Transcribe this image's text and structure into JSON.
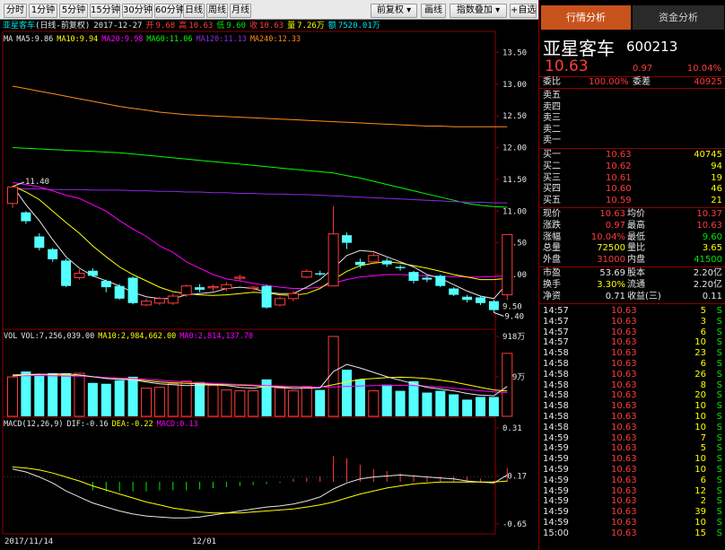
{
  "toolbar": {
    "buttons": [
      "分时",
      "1分钟",
      "5分钟",
      "15分钟",
      "30分钟",
      "60分钟",
      "日线",
      "周线",
      "月线"
    ],
    "restore": "前复权",
    "drawing": "画线",
    "indicator": "指数叠加",
    "selfselect": "+自选"
  },
  "header": {
    "name": "亚星客车",
    "period": "(日线-前复权)",
    "date": "2017-12-27",
    "open_label": "开",
    "open": "9.68",
    "high_label": "高",
    "high": "10.63",
    "low_label": "低",
    "low": "9.60",
    "close_label": "收",
    "close": "10.63",
    "vol_label": "量",
    "vol": "7.26万",
    "amt_label": "额",
    "amt": "7520.01万"
  },
  "ma_legend": [
    {
      "text": "MA",
      "color": "#e6e6e6"
    },
    {
      "text": "MA5:9.86",
      "color": "#e6e6e6"
    },
    {
      "text": "MA10:9.94",
      "color": "#ffff00"
    },
    {
      "text": "MA20:9.98",
      "color": "#ff00ff"
    },
    {
      "text": "MA60:11.06",
      "color": "#00ff00"
    },
    {
      "text": "MA120:11.13",
      "color": "#8a2be2"
    },
    {
      "text": "MA240:12.33",
      "color": "#ff8c1a"
    }
  ],
  "vol_legend": [
    {
      "text": "VOL",
      "color": "#e6e6e6"
    },
    {
      "text": "VOL:7,256,039.00",
      "color": "#e6e6e6"
    },
    {
      "text": "MA10:2,984,662.00",
      "color": "#ffff00"
    },
    {
      "text": "MA0:2,814,137.70",
      "color": "#ff00ff"
    }
  ],
  "macd_legend": [
    {
      "text": "MACD(12,26,9)",
      "color": "#e6e6e6"
    },
    {
      "text": "DIF:-0.16",
      "color": "#e6e6e6"
    },
    {
      "text": "DEA:-0.22",
      "color": "#ffff00"
    },
    {
      "text": "MACD:0.13",
      "color": "#ff00ff"
    }
  ],
  "price_axis": [
    "13.50",
    "13.00",
    "12.50",
    "12.00",
    "11.50",
    "11.00",
    "10.50",
    "10.00",
    "9.50"
  ],
  "vol_axis": [
    "918万",
    "459万"
  ],
  "macd_axis": [
    "0.31",
    "-0.17",
    "-0.65"
  ],
  "date_axis": [
    "2017/11/14",
    "12/01"
  ],
  "annotations": {
    "high": "11.40",
    "low": "9.40"
  },
  "candles": [
    {
      "o": 11.12,
      "c": 11.38,
      "h": 11.4,
      "l": 11.05,
      "v": 458
    },
    {
      "o": 10.98,
      "c": 10.84,
      "h": 11.0,
      "l": 10.8,
      "v": 520
    },
    {
      "o": 10.6,
      "c": 10.42,
      "h": 10.65,
      "l": 10.38,
      "v": 470
    },
    {
      "o": 10.4,
      "c": 10.24,
      "h": 10.42,
      "l": 10.2,
      "v": 500
    },
    {
      "o": 10.22,
      "c": 9.82,
      "h": 10.25,
      "l": 9.8,
      "v": 500
    },
    {
      "o": 9.95,
      "c": 10.02,
      "h": 10.08,
      "l": 9.92,
      "v": 500
    },
    {
      "o": 10.06,
      "c": 9.98,
      "h": 10.1,
      "l": 9.96,
      "v": 390
    },
    {
      "o": 9.9,
      "c": 9.8,
      "h": 9.92,
      "l": 9.72,
      "v": 380
    },
    {
      "o": 9.82,
      "c": 9.62,
      "h": 9.85,
      "l": 9.6,
      "v": 420
    },
    {
      "o": 9.95,
      "c": 9.55,
      "h": 9.97,
      "l": 9.53,
      "v": 460
    },
    {
      "o": 9.52,
      "c": 9.58,
      "h": 9.62,
      "l": 9.5,
      "v": 330
    },
    {
      "o": 9.55,
      "c": 9.62,
      "h": 9.65,
      "l": 9.52,
      "v": 340
    },
    {
      "o": 9.55,
      "c": 9.66,
      "h": 9.7,
      "l": 9.52,
      "v": 380
    },
    {
      "o": 9.68,
      "c": 9.82,
      "h": 9.84,
      "l": 9.65,
      "v": 410
    },
    {
      "o": 9.8,
      "c": 9.76,
      "h": 9.85,
      "l": 9.72,
      "v": 400
    },
    {
      "o": 9.79,
      "c": 9.81,
      "h": 9.84,
      "l": 9.74,
      "v": 360
    },
    {
      "o": 9.78,
      "c": 9.84,
      "h": 9.88,
      "l": 9.74,
      "v": 310
    },
    {
      "o": 9.94,
      "c": 9.96,
      "h": 10.0,
      "l": 9.9,
      "v": 300
    },
    {
      "o": 9.78,
      "c": 9.8,
      "h": 9.82,
      "l": 9.75,
      "v": 300
    },
    {
      "o": 9.82,
      "c": 9.48,
      "h": 9.84,
      "l": 9.46,
      "v": 430
    },
    {
      "o": 9.52,
      "c": 9.62,
      "h": 9.65,
      "l": 9.5,
      "v": 330
    },
    {
      "o": 9.62,
      "c": 9.7,
      "h": 9.74,
      "l": 9.58,
      "v": 300
    },
    {
      "o": 9.96,
      "c": 10.05,
      "h": 10.08,
      "l": 9.94,
      "v": 350
    },
    {
      "o": 10.02,
      "c": 10.0,
      "h": 10.06,
      "l": 9.98,
      "v": 310
    },
    {
      "o": 9.82,
      "c": 10.64,
      "h": 11.08,
      "l": 9.82,
      "v": 918
    },
    {
      "o": 10.62,
      "c": 10.5,
      "h": 10.66,
      "l": 10.4,
      "v": 540
    },
    {
      "o": 10.2,
      "c": 10.15,
      "h": 10.25,
      "l": 10.1,
      "v": 430
    },
    {
      "o": 10.2,
      "c": 10.3,
      "h": 10.34,
      "l": 10.16,
      "v": 300
    },
    {
      "o": 10.22,
      "c": 10.16,
      "h": 10.26,
      "l": 10.12,
      "v": 370
    },
    {
      "o": 10.12,
      "c": 10.1,
      "h": 10.15,
      "l": 10.06,
      "v": 300
    },
    {
      "o": 10.04,
      "c": 9.9,
      "h": 10.06,
      "l": 9.86,
      "v": 410
    },
    {
      "o": 9.95,
      "c": 9.92,
      "h": 9.98,
      "l": 9.88,
      "v": 280
    },
    {
      "o": 9.98,
      "c": 9.82,
      "h": 10.0,
      "l": 9.8,
      "v": 300
    },
    {
      "o": 9.78,
      "c": 9.68,
      "h": 9.8,
      "l": 9.66,
      "v": 260
    },
    {
      "o": 9.65,
      "c": 9.6,
      "h": 9.68,
      "l": 9.56,
      "v": 200
    },
    {
      "o": 9.64,
      "c": 9.55,
      "h": 9.66,
      "l": 9.52,
      "v": 230
    },
    {
      "o": 9.58,
      "c": 9.44,
      "h": 9.6,
      "l": 9.4,
      "v": 230
    },
    {
      "o": 9.68,
      "c": 10.63,
      "h": 10.63,
      "l": 9.6,
      "v": 726
    }
  ],
  "ma_lines": [
    {
      "color": "#ff8c1a",
      "values": [
        12.97,
        12.93,
        12.89,
        12.85,
        12.81,
        12.77,
        12.73,
        12.69,
        12.65,
        12.62,
        12.59,
        12.56,
        12.54,
        12.52,
        12.51,
        12.5,
        12.49,
        12.48,
        12.47,
        12.46,
        12.45,
        12.44,
        12.43,
        12.42,
        12.41,
        12.4,
        12.39,
        12.38,
        12.37,
        12.36,
        12.35,
        12.34,
        12.34,
        12.33,
        12.33,
        12.33,
        12.33,
        12.33
      ]
    },
    {
      "color": "#00ff00",
      "values": [
        12.0,
        11.99,
        11.98,
        11.97,
        11.96,
        11.95,
        11.94,
        11.93,
        11.92,
        11.9,
        11.88,
        11.86,
        11.84,
        11.82,
        11.8,
        11.78,
        11.76,
        11.74,
        11.72,
        11.7,
        11.68,
        11.66,
        11.64,
        11.62,
        11.6,
        11.56,
        11.52,
        11.47,
        11.42,
        11.37,
        11.32,
        11.27,
        11.22,
        11.17,
        11.12,
        11.09,
        11.07,
        11.06
      ]
    },
    {
      "color": "#8a2be2",
      "values": [
        11.35,
        11.35,
        11.35,
        11.34,
        11.34,
        11.34,
        11.33,
        11.33,
        11.33,
        11.32,
        11.32,
        11.31,
        11.31,
        11.3,
        11.3,
        11.29,
        11.29,
        11.28,
        11.28,
        11.27,
        11.27,
        11.26,
        11.26,
        11.25,
        11.24,
        11.23,
        11.22,
        11.21,
        11.2,
        11.19,
        11.18,
        11.17,
        11.16,
        11.15,
        11.14,
        11.14,
        11.13,
        11.13
      ]
    },
    {
      "color": "#ff00ff",
      "values": [
        11.45,
        11.42,
        11.38,
        11.32,
        11.25,
        11.2,
        11.1,
        11.0,
        10.85,
        10.72,
        10.6,
        10.45,
        10.35,
        10.2,
        10.1,
        10.0,
        9.93,
        9.9,
        9.86,
        9.83,
        9.8,
        9.78,
        9.78,
        9.8,
        9.86,
        9.92,
        9.96,
        9.98,
        10.0,
        10.0,
        9.99,
        9.98,
        9.97,
        9.97,
        9.96,
        9.96,
        9.97,
        9.98
      ]
    },
    {
      "color": "#ffff00",
      "values": [
        11.4,
        11.3,
        11.18,
        11.0,
        10.82,
        10.65,
        10.45,
        10.28,
        10.12,
        10.0,
        9.9,
        9.8,
        9.73,
        9.7,
        9.68,
        9.67,
        9.68,
        9.7,
        9.72,
        9.71,
        9.68,
        9.67,
        9.7,
        9.78,
        9.92,
        10.05,
        10.14,
        10.18,
        10.2,
        10.18,
        10.14,
        10.1,
        10.05,
        10.0,
        9.96,
        9.92,
        9.92,
        9.94
      ]
    },
    {
      "color": "#e6e6e6",
      "values": [
        11.4,
        11.1,
        10.85,
        10.55,
        10.28,
        10.1,
        9.98,
        9.9,
        9.82,
        9.72,
        9.65,
        9.62,
        9.62,
        9.68,
        9.7,
        9.72,
        9.78,
        9.8,
        9.78,
        9.72,
        9.7,
        9.7,
        9.8,
        9.92,
        10.1,
        10.3,
        10.38,
        10.36,
        10.28,
        10.2,
        10.12,
        10.0,
        9.94,
        9.84,
        9.74,
        9.66,
        9.62,
        9.86
      ]
    }
  ],
  "vol_ma_lines": [
    {
      "color": "#ffff00",
      "values": [
        480,
        485,
        490,
        485,
        478,
        470,
        460,
        450,
        440,
        430,
        415,
        400,
        392,
        385,
        380,
        375,
        370,
        365,
        358,
        352,
        348,
        345,
        342,
        340,
        370,
        400,
        430,
        440,
        450,
        455,
        450,
        440,
        420,
        400,
        370,
        340,
        310,
        298
      ]
    },
    {
      "color": "#ff00ff",
      "values": [
        470,
        472,
        474,
        470,
        468,
        466,
        460,
        452,
        445,
        440,
        430,
        420,
        410,
        400,
        392,
        385,
        378,
        372,
        366,
        360,
        355,
        350,
        345,
        342,
        345,
        350,
        356,
        360,
        362,
        362,
        360,
        352,
        342,
        330,
        315,
        300,
        288,
        281
      ]
    },
    {
      "color": "#e6e6e6",
      "values": [
        470,
        480,
        486,
        490,
        495,
        480,
        460,
        440,
        430,
        425,
        400,
        380,
        370,
        360,
        365,
        370,
        360,
        340,
        330,
        350,
        340,
        325,
        330,
        335,
        520,
        600,
        560,
        510,
        460,
        420,
        380,
        340,
        320,
        300,
        270,
        250,
        245,
        350
      ]
    }
  ],
  "macd": {
    "bars": [
      0,
      0,
      0,
      0,
      0,
      0,
      -0.08,
      -0.09,
      -0.09,
      -0.09,
      -0.09,
      -0.08,
      -0.08,
      -0.08,
      -0.07,
      -0.06,
      -0.05,
      -0.04,
      -0.03,
      -0.02,
      -0.01,
      0.03,
      0.04,
      0.05,
      0.24,
      0.22,
      0.16,
      0.12,
      0.1,
      0.08,
      0.06,
      0.05,
      0.05,
      0.05,
      0.05,
      0.03,
      0.01,
      0.13
    ],
    "dif": [
      -0.1,
      -0.13,
      -0.18,
      -0.24,
      -0.32,
      -0.38,
      -0.44,
      -0.48,
      -0.52,
      -0.55,
      -0.57,
      -0.58,
      -0.59,
      -0.59,
      -0.58,
      -0.56,
      -0.54,
      -0.52,
      -0.5,
      -0.48,
      -0.47,
      -0.45,
      -0.42,
      -0.38,
      -0.3,
      -0.24,
      -0.2,
      -0.18,
      -0.17,
      -0.16,
      -0.17,
      -0.18,
      -0.19,
      -0.2,
      -0.22,
      -0.23,
      -0.24,
      -0.16
    ],
    "dea": [
      -0.08,
      -0.09,
      -0.11,
      -0.14,
      -0.18,
      -0.22,
      -0.27,
      -0.31,
      -0.35,
      -0.39,
      -0.43,
      -0.46,
      -0.49,
      -0.51,
      -0.53,
      -0.54,
      -0.54,
      -0.54,
      -0.53,
      -0.52,
      -0.51,
      -0.5,
      -0.48,
      -0.46,
      -0.43,
      -0.39,
      -0.35,
      -0.32,
      -0.29,
      -0.27,
      -0.25,
      -0.24,
      -0.23,
      -0.23,
      -0.23,
      -0.23,
      -0.23,
      -0.22
    ]
  },
  "right": {
    "tabs": [
      "行情分析",
      "资金分析"
    ],
    "name": "亚星客车",
    "code": "600213",
    "price": "10.63",
    "change": "0.97",
    "pct": "10.04%",
    "ratio": {
      "l1": "委比",
      "v1": "100.00%",
      "l2": "委差",
      "v2": "40925"
    },
    "asks": [
      "卖五",
      "卖四",
      "卖三",
      "卖二",
      "卖一"
    ],
    "bids": [
      {
        "label": "买一",
        "price": "10.63",
        "vol": "40745"
      },
      {
        "label": "买二",
        "price": "10.62",
        "vol": "94"
      },
      {
        "label": "买三",
        "price": "10.61",
        "vol": "19"
      },
      {
        "label": "买四",
        "price": "10.60",
        "vol": "46"
      },
      {
        "label": "买五",
        "price": "10.59",
        "vol": "21"
      }
    ],
    "stats": [
      {
        "l1": "现价",
        "v1": "10.63",
        "c1": "r",
        "l2": "均价",
        "v2": "10.37",
        "c2": "r"
      },
      {
        "l1": "涨跌",
        "v1": "0.97",
        "c1": "r",
        "l2": "最高",
        "v2": "10.63",
        "c2": "r"
      },
      {
        "l1": "涨幅",
        "v1": "10.04%",
        "c1": "r",
        "l2": "最低",
        "v2": "9.60",
        "c2": "g"
      },
      {
        "l1": "总量",
        "v1": "72500",
        "c1": "y",
        "l2": "量比",
        "v2": "3.65",
        "c2": "y"
      },
      {
        "l1": "外盘",
        "v1": "31000",
        "c1": "r",
        "l2": "内盘",
        "v2": "41500",
        "c2": "g"
      }
    ],
    "fund": [
      {
        "l1": "市盈",
        "v1": "53.69",
        "c1": "w",
        "l2": "股本",
        "v2": "2.20亿",
        "c2": "w"
      },
      {
        "l1": "换手",
        "v1": "3.30%",
        "c1": "y",
        "l2": "流通",
        "v2": "2.20亿",
        "c2": "w"
      },
      {
        "l1": "净资",
        "v1": "0.71",
        "c1": "w",
        "l2": "收益(三)",
        "v2": "0.11",
        "c2": "w"
      }
    ],
    "ticks": [
      {
        "t": "14:57",
        "p": "10.63",
        "v": "5",
        "s": "S"
      },
      {
        "t": "14:57",
        "p": "10.63",
        "v": "3",
        "s": "S"
      },
      {
        "t": "14:57",
        "p": "10.63",
        "v": "6",
        "s": "S"
      },
      {
        "t": "14:57",
        "p": "10.63",
        "v": "10",
        "s": "S"
      },
      {
        "t": "14:58",
        "p": "10.63",
        "v": "23",
        "s": "S"
      },
      {
        "t": "14:58",
        "p": "10.63",
        "v": "6",
        "s": "S"
      },
      {
        "t": "14:58",
        "p": "10.63",
        "v": "26",
        "s": "S"
      },
      {
        "t": "14:58",
        "p": "10.63",
        "v": "8",
        "s": "S"
      },
      {
        "t": "14:58",
        "p": "10.63",
        "v": "20",
        "s": "S"
      },
      {
        "t": "14:58",
        "p": "10.63",
        "v": "10",
        "s": "S"
      },
      {
        "t": "14:58",
        "p": "10.63",
        "v": "10",
        "s": "S"
      },
      {
        "t": "14:58",
        "p": "10.63",
        "v": "10",
        "s": "S"
      },
      {
        "t": "14:59",
        "p": "10.63",
        "v": "7",
        "s": "S"
      },
      {
        "t": "14:59",
        "p": "10.63",
        "v": "5",
        "s": "S"
      },
      {
        "t": "14:59",
        "p": "10.63",
        "v": "10",
        "s": "S"
      },
      {
        "t": "14:59",
        "p": "10.63",
        "v": "10",
        "s": "S"
      },
      {
        "t": "14:59",
        "p": "10.63",
        "v": "6",
        "s": "S"
      },
      {
        "t": "14:59",
        "p": "10.63",
        "v": "12",
        "s": "S"
      },
      {
        "t": "14:59",
        "p": "10.63",
        "v": "2",
        "s": "S"
      },
      {
        "t": "14:59",
        "p": "10.63",
        "v": "39",
        "s": "S"
      },
      {
        "t": "14:59",
        "p": "10.63",
        "v": "10",
        "s": "S"
      },
      {
        "t": "15:00",
        "p": "10.63",
        "v": "15",
        "s": "S"
      }
    ]
  }
}
